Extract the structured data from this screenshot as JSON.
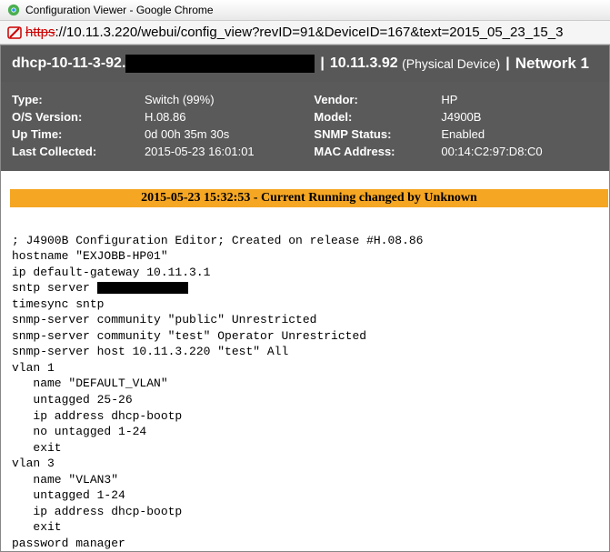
{
  "window": {
    "title": "Configuration Viewer - Google Chrome"
  },
  "address": {
    "scheme": "https",
    "rest": "://10.11.3.220/webui/config_view?revID=91&DeviceID=167&text=2015_05_23_15_3"
  },
  "header": {
    "hostname": "dhcp-10-11-3-92.",
    "ip": "10.11.3.92",
    "phys": "(Physical Device)",
    "net": "Network 1"
  },
  "info": {
    "type_lbl": "Type:",
    "type_val": "Switch (99%)",
    "os_lbl": "O/S Version:",
    "os_val": "H.08.86",
    "up_lbl": "Up Time:",
    "up_val": "0d 00h 35m 30s",
    "lc_lbl": "Last Collected:",
    "lc_val": "2015-05-23 16:01:01",
    "vendor_lbl": "Vendor:",
    "vendor_val": "HP",
    "model_lbl": "Model:",
    "model_val": "J4900B",
    "snmp_lbl": "SNMP Status:",
    "snmp_val": "Enabled",
    "mac_lbl": "MAC Address:",
    "mac_val": "00:14:C2:97:D8:C0"
  },
  "banner": "2015-05-23 15:32:53 - Current Running changed by Unknown",
  "config_pre": "\n; J4900B Configuration Editor; Created on release #H.08.86\nhostname \"EXJOBB-HP01\"\nip default-gateway 10.11.3.1\nsntp server ",
  "config_post": "\ntimesync sntp\nsnmp-server community \"public\" Unrestricted\nsnmp-server community \"test\" Operator Unrestricted\nsnmp-server host 10.11.3.220 \"test\" All\nvlan 1\n   name \"DEFAULT_VLAN\"\n   untagged 25-26\n   ip address dhcp-bootp\n   no untagged 1-24\n   exit\nvlan 3\n   name \"VLAN3\"\n   untagged 1-24\n   ip address dhcp-bootp\n   exit\npassword manager"
}
